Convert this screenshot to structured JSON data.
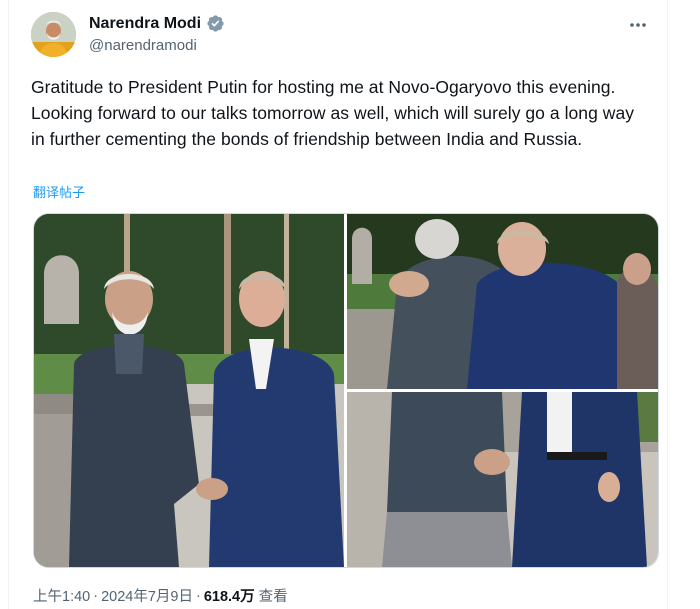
{
  "author": {
    "display_name": "Narendra Modi",
    "handle": "@narendramodi",
    "verified": true,
    "avatar_icon": "profile-avatar",
    "verified_color": "#829aab"
  },
  "header": {
    "more_icon": "more-horizontal-icon"
  },
  "tweet": {
    "text": "Gratitude to President Putin for hosting me at Novo-Ogaryovo this evening. Looking forward to our talks tomorrow as well, which will surely go a long way in further cementing the bonds of friendship between India and Russia.",
    "translate_label": "翻译帖子"
  },
  "media": {
    "count": 3
  },
  "meta": {
    "time": "上午1:40",
    "date": "2024年7月9日",
    "separator": "·",
    "views_count": "618.4万",
    "views_label": "查看"
  },
  "colors": {
    "text_primary": "#0f1419",
    "text_secondary": "#536471",
    "link": "#1d9bf0",
    "border": "#cfd9de"
  }
}
